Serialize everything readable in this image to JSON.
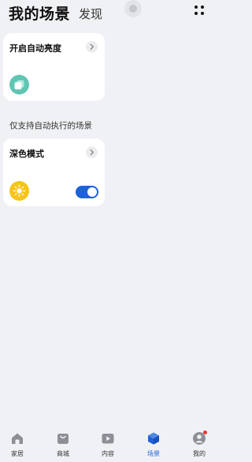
{
  "header": {
    "active_tab": "我的场景",
    "inactive_tab": "发现",
    "more_icon": "more-dots-icon"
  },
  "cards": [
    {
      "title": "开启自动亮度",
      "icon": "brightness-icon",
      "icon_color": "#5fc6b3"
    },
    {
      "title": "深色模式",
      "icon": "sun-icon",
      "icon_color": "#f5c518",
      "toggle_on": true
    }
  ],
  "section_label": "仅支持自动执行的场景",
  "bottom_nav": {
    "items": [
      {
        "label": "家居",
        "icon": "home-icon",
        "active": false
      },
      {
        "label": "商城",
        "icon": "shop-icon",
        "active": false
      },
      {
        "label": "内容",
        "icon": "play-icon",
        "active": false
      },
      {
        "label": "场景",
        "icon": "cube-icon",
        "active": true
      },
      {
        "label": "我的",
        "icon": "profile-icon",
        "active": false,
        "badge": true
      }
    ]
  },
  "colors": {
    "accent": "#1e62d9",
    "background": "#f0f1f5",
    "badge": "#e53935"
  }
}
